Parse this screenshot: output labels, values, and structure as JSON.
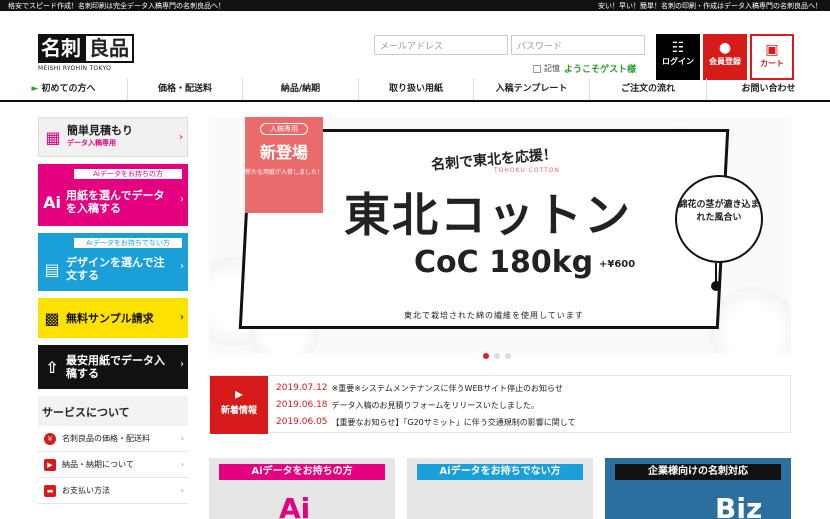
{
  "topbar": {
    "left": "格安でスピード作成！名刺印刷は完全データ入稿専門の名刺良品へ！",
    "right": "安い！早い！簡単！名刺の印刷・作成はデータ入稿専門の名刺良品へ！"
  },
  "logo": {
    "part1": "名刺",
    "part2": "良品",
    "sub": "MEISHI RYOHIN TOKYO"
  },
  "login": {
    "email_placeholder": "メールアドレス",
    "password_placeholder": "パスワード",
    "remember": "記憶",
    "guest": "ようこそゲスト様"
  },
  "header_buttons": {
    "login": "ログイン",
    "member": "会員登録",
    "cart": "カート"
  },
  "nav": [
    "初めての方へ",
    "価格・配送料",
    "納品/納期",
    "取り扱い用紙",
    "入稿テンプレート",
    "ご注文の流れ",
    "お問い合わせ"
  ],
  "sidebar": {
    "estimate": {
      "title": "簡単見積もり",
      "sub": "データ入稿専用"
    },
    "ai_have": {
      "tag": "Aiデータをお持ちの方",
      "text": "用紙を選んでデータを入稿する",
      "icon": "Ai"
    },
    "ai_none": {
      "tag": "Aiデータをお持ちでない方",
      "text": "デザインを選んで注文する"
    },
    "sample": {
      "text": "無料サンプル請求"
    },
    "cheapest": {
      "text": "最安用紙でデータ入稿する"
    },
    "services_title": "サービスについて",
    "services": [
      "名刺良品の価格・配送料",
      "納品・納期について",
      "お支払い方法"
    ]
  },
  "banner": {
    "ribbon_tag": "入稿専用",
    "ribbon_title": "新登場",
    "ribbon_sub": "新たな用紙が入荷しました！",
    "headline": "名刺で東北を応援！",
    "small": "TOHOKU COTTON",
    "title": "東北コットン",
    "coc": "CoC 180kg",
    "price": "+¥600",
    "circle": "綿花の茎が漉き込まれた風合い",
    "desc": "東北で栽培された綿の繊維を使用しています"
  },
  "news": {
    "title": "新着情報",
    "items": [
      {
        "date": "2019.07.12",
        "text": "※重要※システムメンテナンスに伴うWEBサイト停止のお知らせ"
      },
      {
        "date": "2019.06.18",
        "text": "データ入稿のお見積りフォームをリリースいたしました。"
      },
      {
        "date": "2019.06.05",
        "text": "【重要なお知らせ】「G20サミット」に伴う交通規制の影響に関して"
      }
    ]
  },
  "cards": [
    {
      "label": "Aiデータをお持ちの方",
      "big": "Ai"
    },
    {
      "label": "Aiデータをお持ちでない方",
      "big": ""
    },
    {
      "label": "企業様向けの名刺対応",
      "big": "Biz"
    }
  ],
  "colors": {
    "red": "#d71a1a",
    "pink": "#e4007f",
    "blue": "#1a9fd9",
    "yellow": "#ffe100",
    "green": "#2a9d2a"
  }
}
